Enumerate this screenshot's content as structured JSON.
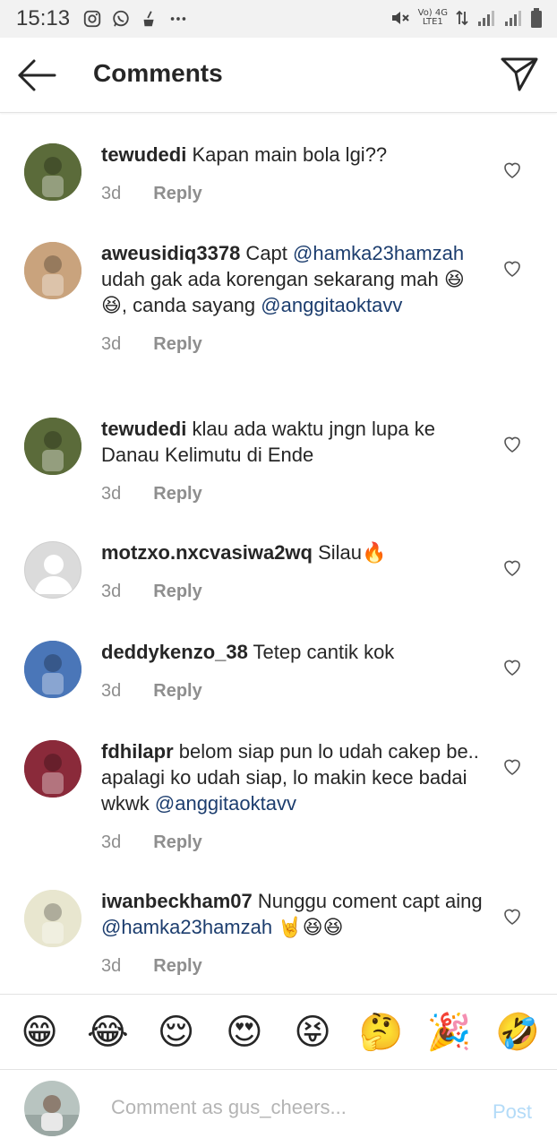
{
  "status_bar": {
    "time": "15:13",
    "network_top": "Vo) 4G",
    "network_bottom": "LTE1"
  },
  "header": {
    "title": "Comments",
    "back_icon": "arrow-left-icon",
    "send_icon": "paper-plane-icon"
  },
  "comments": [
    {
      "username": "tewudedi",
      "parts": [
        {
          "text": " Kapan main bola lgi??",
          "mention": false
        }
      ],
      "age": "3d",
      "reply_label": "Reply",
      "avatar_color": "#5b6b3a"
    },
    {
      "username": "aweusidiq3378",
      "parts": [
        {
          "text": " Capt ",
          "mention": false
        },
        {
          "text": "@hamka23hamzah",
          "mention": true
        },
        {
          "text": " udah gak ada korengan sekarang mah 😆😆, canda sayang ",
          "mention": false
        },
        {
          "text": "@anggitaoktavv",
          "mention": true
        }
      ],
      "age": "3d",
      "reply_label": "Reply",
      "avatar_color": "#c9a37d"
    },
    {
      "username": "tewudedi",
      "parts": [
        {
          "text": " klau ada waktu jngn lupa ke Danau Kelimutu di Ende",
          "mention": false
        }
      ],
      "age": "3d",
      "reply_label": "Reply",
      "avatar_color": "#5b6b3a"
    },
    {
      "username": "motzxo.nxcvasiwa2wq",
      "parts": [
        {
          "text": " Silau🔥",
          "mention": false
        }
      ],
      "age": "3d",
      "reply_label": "Reply",
      "avatar_color": "#dbdbdb"
    },
    {
      "username": "deddykenzo_38",
      "parts": [
        {
          "text": " Tetep cantik kok",
          "mention": false
        }
      ],
      "age": "3d",
      "reply_label": "Reply",
      "avatar_color": "#4a76b8"
    },
    {
      "username": "fdhilapr",
      "parts": [
        {
          "text": " belom siap pun lo udah cakep be.. apalagi ko udah siap, lo makin kece badai wkwk ",
          "mention": false
        },
        {
          "text": "@anggitaoktavv",
          "mention": true
        }
      ],
      "age": "3d",
      "reply_label": "Reply",
      "avatar_color": "#8a2a3a"
    },
    {
      "username": "iwanbeckham07",
      "parts": [
        {
          "text": " Nunggu coment capt aing ",
          "mention": false
        },
        {
          "text": "@hamka23hamzah",
          "mention": true
        },
        {
          "text": " 🤘😆😆",
          "mention": false
        }
      ],
      "age": "3d",
      "reply_label": "Reply",
      "avatar_color": "#e8e6cf"
    }
  ],
  "emoji_bar": [
    "😁",
    "😂",
    "😌",
    "😍",
    "😝",
    "🤔",
    "🎉",
    "🤣"
  ],
  "composer": {
    "placeholder": "Comment as gus_cheers...",
    "post_label": "Post",
    "avatar_color": "#b8c4c0"
  },
  "colors": {
    "mention": "#1c3d6e",
    "post_disabled": "#b3dbf8",
    "meta": "#8e8e8e"
  }
}
